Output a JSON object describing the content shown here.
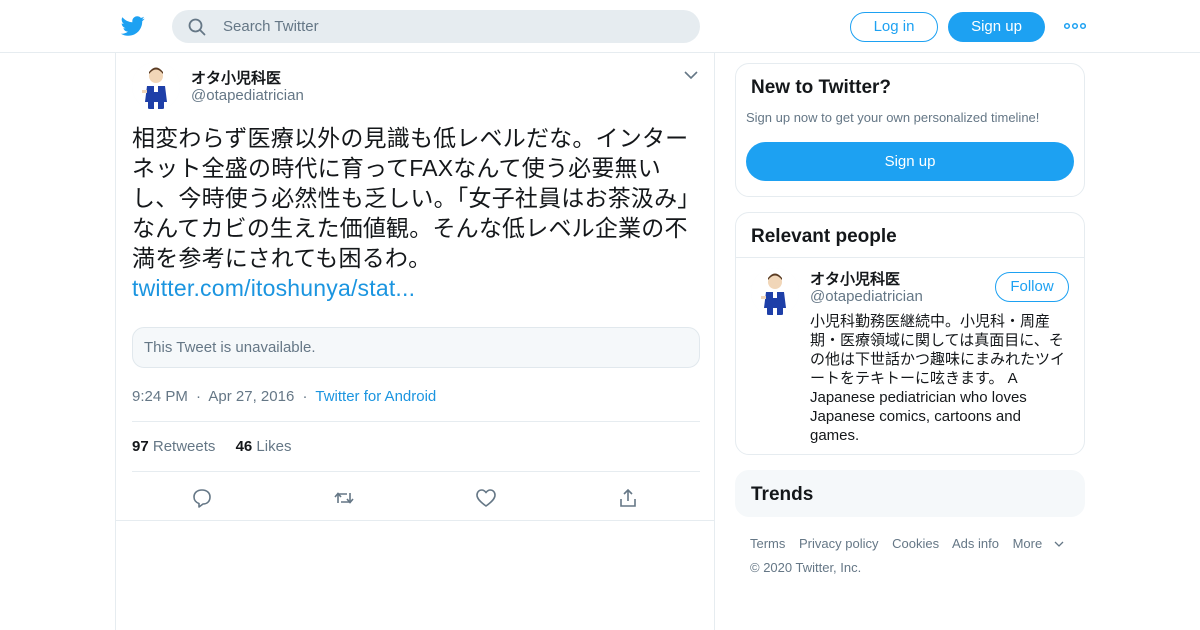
{
  "header": {
    "search_placeholder": "Search Twitter",
    "login_label": "Log in",
    "signup_label": "Sign up"
  },
  "tweet": {
    "author_name": "オタ小児科医",
    "author_handle": "@otapediatrician",
    "text": "相変わらず医療以外の見識も低レベルだな。インターネット全盛の時代に育ってFAXなんて使う必要無いし、今時使う必然性も乏しい。「女子社員はお茶汲み」なんてカビの生えた価値観。そんな低レベル企業の不満を参考にされても困るわ。",
    "link_text": "twitter.com/itoshunya/stat...",
    "quote_unavailable": "This Tweet is unavailable.",
    "time": "9:24 PM",
    "date": "Apr 27, 2016",
    "source": "Twitter for Android",
    "separator": "·",
    "retweets_count": "97",
    "retweets_label": "Retweets",
    "likes_count": "46",
    "likes_label": "Likes"
  },
  "sidebar": {
    "new_to_twitter": {
      "title": "New to Twitter?",
      "subtitle": "Sign up now to get your own personalized timeline!",
      "button_label": "Sign up"
    },
    "relevant_people": {
      "title": "Relevant people",
      "person": {
        "name": "オタ小児科医",
        "handle": "@otapediatrician",
        "follow_label": "Follow",
        "bio": "小児科勤務医継続中。小児科・周産期・医療領域に関しては真面目に、その他は下世話かつ趣味にまみれたツイートをテキトーに呟きます。 A Japanese pediatrician who loves Japanese comics, cartoons and games."
      }
    },
    "trends": {
      "title": "Trends"
    }
  },
  "footer": {
    "links": [
      "Terms",
      "Privacy policy",
      "Cookies",
      "Ads info",
      "More"
    ],
    "copyright": "© 2020 Twitter, Inc."
  },
  "icons": {
    "logo": "twitter-bird-icon",
    "search": "search-icon",
    "more": "more-dots-icon",
    "caret": "chevron-down-icon",
    "reply": "reply-icon",
    "retweet": "retweet-icon",
    "like": "heart-icon",
    "share": "share-icon"
  },
  "colors": {
    "accent": "#1da1f2",
    "link": "#1b95e0",
    "secondary_text": "#657786",
    "border": "#e6ecf0"
  }
}
